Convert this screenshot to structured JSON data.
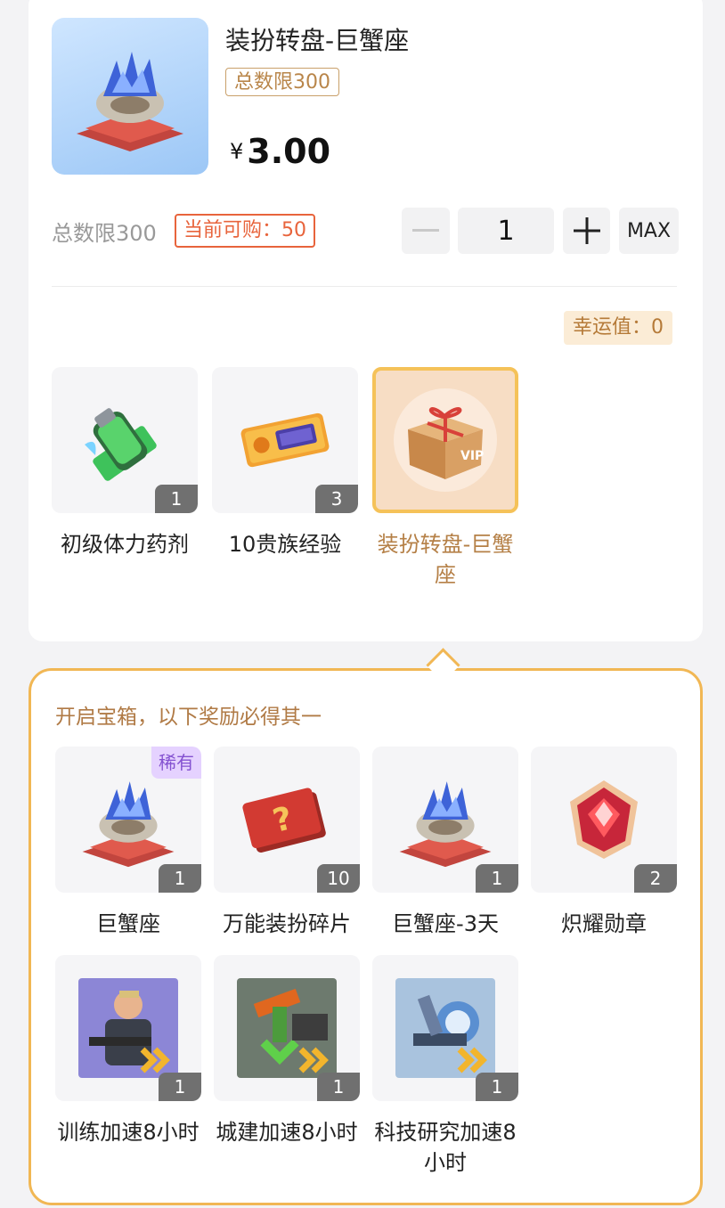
{
  "product": {
    "title": "装扮转盘-巨蟹座",
    "limit_tag": "总数限300",
    "currency": "¥",
    "price": "3.00"
  },
  "purchase": {
    "total_limit": "总数限300",
    "can_buy": "当前可购：50",
    "quantity": "1",
    "minus_icon": "minus-icon",
    "plus_icon": "plus-icon",
    "max_label": "MAX"
  },
  "luck": {
    "label": "幸运值：0"
  },
  "bundle": [
    {
      "name": "初级体力药剂",
      "count": "1",
      "icon": "stamina-potion-icon"
    },
    {
      "name": "10贵族经验",
      "count": "3",
      "icon": "noble-exp-ticket-icon"
    },
    {
      "name": "装扮转盘-巨蟹座",
      "icon": "gift-box-icon",
      "selected": true
    }
  ],
  "rewards": {
    "title": "开启宝箱，以下奖励必得其一",
    "items": [
      {
        "name": "巨蟹座",
        "count": "1",
        "badge": "稀有",
        "icon": "cancer-pedestal-icon"
      },
      {
        "name": "万能装扮碎片",
        "count": "10",
        "icon": "mystery-card-icon"
      },
      {
        "name": "巨蟹座-3天",
        "count": "1",
        "icon": "cancer-pedestal-icon"
      },
      {
        "name": "炽耀勋章",
        "count": "2",
        "icon": "red-medal-icon"
      },
      {
        "name": "训练加速8小时",
        "count": "1",
        "icon": "training-speedup-icon"
      },
      {
        "name": "城建加速8小时",
        "count": "1",
        "icon": "construction-speedup-icon"
      },
      {
        "name": "科技研究加速8小时",
        "count": "1",
        "icon": "research-speedup-icon"
      }
    ]
  },
  "colors": {
    "accent_gold": "#f1b754",
    "warning_orange": "#e8643c",
    "rare_purple": "#8452d1"
  }
}
